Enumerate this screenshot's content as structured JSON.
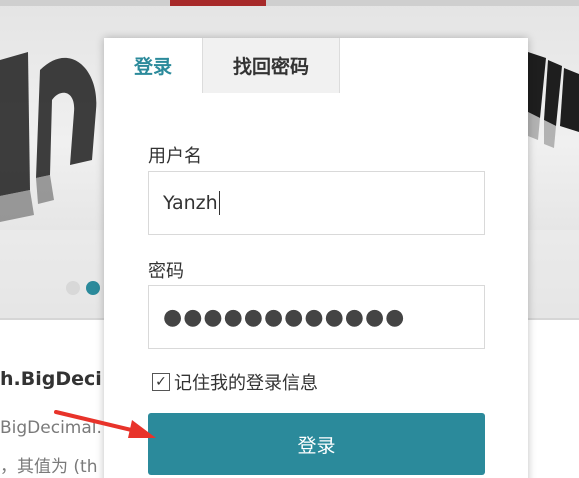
{
  "background": {
    "article_title": "h.BigDeci",
    "article_line1": "BigDecimal.",
    "article_line2": "，其值为 (th",
    "slider": {
      "dot_count": 2,
      "active_index": 1
    }
  },
  "login_panel": {
    "tabs": [
      {
        "label": "登录",
        "active": true
      },
      {
        "label": "找回密码",
        "active": false
      }
    ],
    "username": {
      "label": "用户名",
      "value": "Yanzh"
    },
    "password": {
      "label": "密码",
      "masked_value": "●●●●●●●●●●●●"
    },
    "remember": {
      "checked": true,
      "label": "记住我的登录信息"
    },
    "submit_label": "登录"
  },
  "colors": {
    "accent": "#2b8a9b",
    "annotation_arrow": "#e8332a",
    "brand_mark": "#a72a2a"
  }
}
